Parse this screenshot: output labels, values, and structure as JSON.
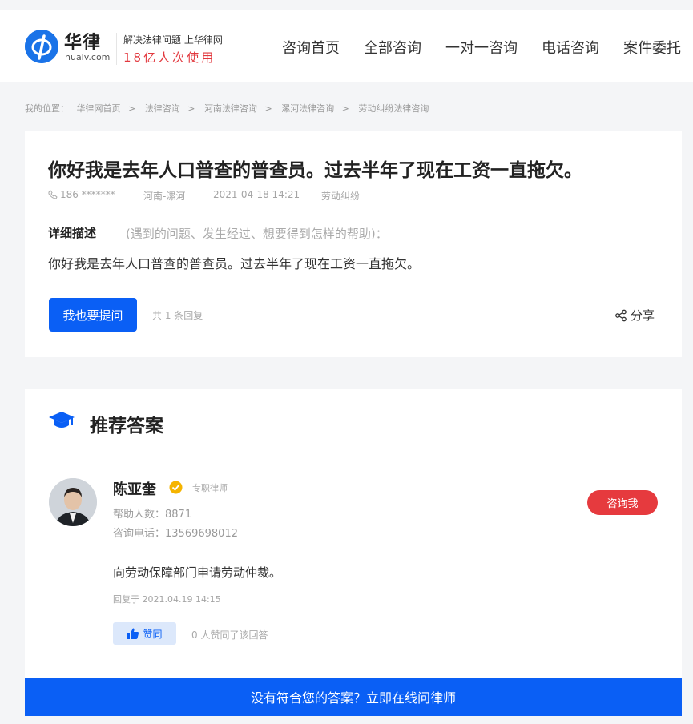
{
  "header": {
    "logo_name": "华律",
    "logo_domain": "hualv.com",
    "slogan_line1": "解决法律问题 上华律网",
    "slogan_line2": "18亿人次使用",
    "nav": [
      "咨询首页",
      "全部咨询",
      "一对一咨询",
      "电话咨询",
      "案件委托"
    ]
  },
  "breadcrumb": {
    "prefix": "我的位置：",
    "items": [
      "华律网首页",
      "法律咨询",
      "河南法律咨询",
      "漯河法律咨询",
      "劳动纠纷法律咨询"
    ],
    "separator": ">"
  },
  "question": {
    "title": "你好我是去年人口普查的普查员。过去半年了现在工资一直拖欠。",
    "phone": "186 *******",
    "area": "河南-漯河",
    "date": "2021-04-18 14:21",
    "category": "劳动纠纷",
    "desc_label": "详细描述",
    "desc_hint": "(遇到的问题、发生经过、想要得到怎样的帮助)：",
    "desc_text": "你好我是去年人口普查的普查员。过去半年了现在工资一直拖欠。",
    "ask_button": "我也要提问",
    "reply_count": "共 1 条回复",
    "share_label": "分享"
  },
  "answer": {
    "section_title": "推荐答案",
    "lawyer_name": "陈亚奎",
    "lawyer_tag": "专职律师",
    "help_count": "帮助人数：8871",
    "contact_phone": "咨询电话：13569698012",
    "consult_button": "咨询我",
    "text": "向劳动保障部门申请劳动仲裁。",
    "reply_time": "回复于 2021.04.19 14:15",
    "like_button": "赞同",
    "like_count": "0 人赞同了该回答",
    "bottom_cta": "没有符合您的答案？立即在线问律师"
  },
  "colors": {
    "brand_blue": "#0a5ff5",
    "accent_red": "#e63a3e",
    "slogan_red": "#e2393f"
  },
  "icons": [
    "phone-icon",
    "graduation-cap-icon",
    "verified-badge-icon",
    "share-icon",
    "thumbs-up-icon"
  ]
}
